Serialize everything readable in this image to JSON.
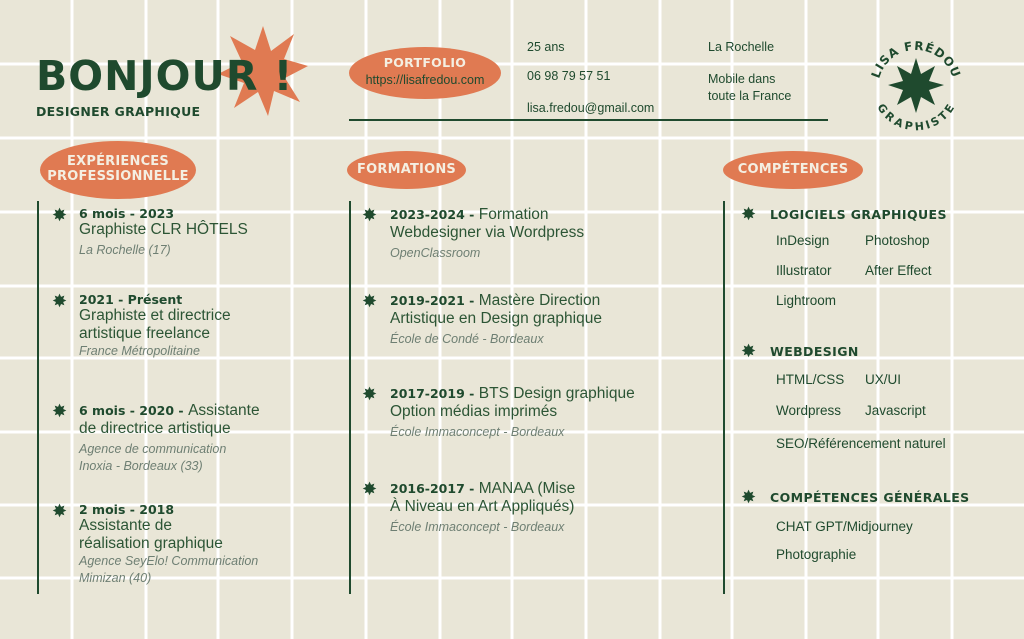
{
  "header": {
    "greeting": "BONJOUR !",
    "role": "DESIGNER GRAPHIQUE",
    "portfolio_label": "PORTFOLIO",
    "portfolio_url": "https://lisafredou.com",
    "age": "25 ans",
    "phone": "06 98 79 57 51",
    "email": "lisa.fredou@gmail.com",
    "city": "La Rochelle",
    "mobility": [
      "Mobile dans",
      "toute la France"
    ],
    "badge_top": "LISA FRÉDOU",
    "badge_bottom": "GRAPHISTE"
  },
  "colors": {
    "background": "#e9e6d7",
    "green": "#1f4a2e",
    "orange": "#e07a52",
    "grid": "#ffffff"
  },
  "experiences": {
    "title": [
      "EXPÉRIENCES",
      "PROFESSIONNELLE"
    ],
    "items": [
      {
        "date": "6 mois - 2023",
        "title": [
          "Graphiste CLR HÔTELS"
        ],
        "place": [
          "La Rochelle (17)"
        ]
      },
      {
        "date": "2021 - Présent",
        "title": [
          "Graphiste et directrice",
          "artistique freelance"
        ],
        "place": [
          "France Métropolitaine"
        ]
      },
      {
        "date": "6 mois - 2020 -",
        "title_inline": "Assistante",
        "title": [
          "de directrice artistique"
        ],
        "place": [
          "Agence de communication",
          "Inoxia - Bordeaux (33)"
        ]
      },
      {
        "date": "2 mois - 2018",
        "title": [
          "Assistante de",
          "réalisation graphique"
        ],
        "place": [
          "Agence SeyElo! Communication",
          "Mimizan (40)"
        ]
      }
    ]
  },
  "formations": {
    "title": "FORMATIONS",
    "items": [
      {
        "date": "2023-2024 -",
        "title_inline": "Formation",
        "title": [
          "Webdesigner via Wordpress"
        ],
        "place": "OpenClassroom"
      },
      {
        "date": "2019-2021 -",
        "title_inline": "Mastère Direction",
        "title": [
          "Artistique en Design graphique"
        ],
        "place": "École de Condé - Bordeaux"
      },
      {
        "date": "2017-2019 -",
        "title_inline": "BTS Design graphique",
        "title": [
          "Option médias imprimés"
        ],
        "place": "École Immaconcept - Bordeaux"
      },
      {
        "date": "2016-2017 -",
        "title_inline": "MANAA (Mise",
        "title": [
          "À Niveau en Art Appliqués)"
        ],
        "place": "École Immaconcept - Bordeaux"
      }
    ]
  },
  "competences": {
    "title": "COMPÉTENCES",
    "groups": [
      {
        "heading": "LOGICIELS GRAPHIQUES",
        "items": [
          "InDesign",
          "Photoshop",
          "Illustrator",
          "After Effect",
          "Lightroom"
        ]
      },
      {
        "heading": "WEBDESIGN",
        "items": [
          "HTML/CSS",
          "UX/UI",
          "Wordpress",
          "Javascript",
          "SEO/Référencement naturel"
        ]
      },
      {
        "heading": "COMPÉTENCES GÉNÉRALES",
        "items": [
          "CHAT GPT/Midjourney",
          "Photographie"
        ]
      }
    ]
  }
}
